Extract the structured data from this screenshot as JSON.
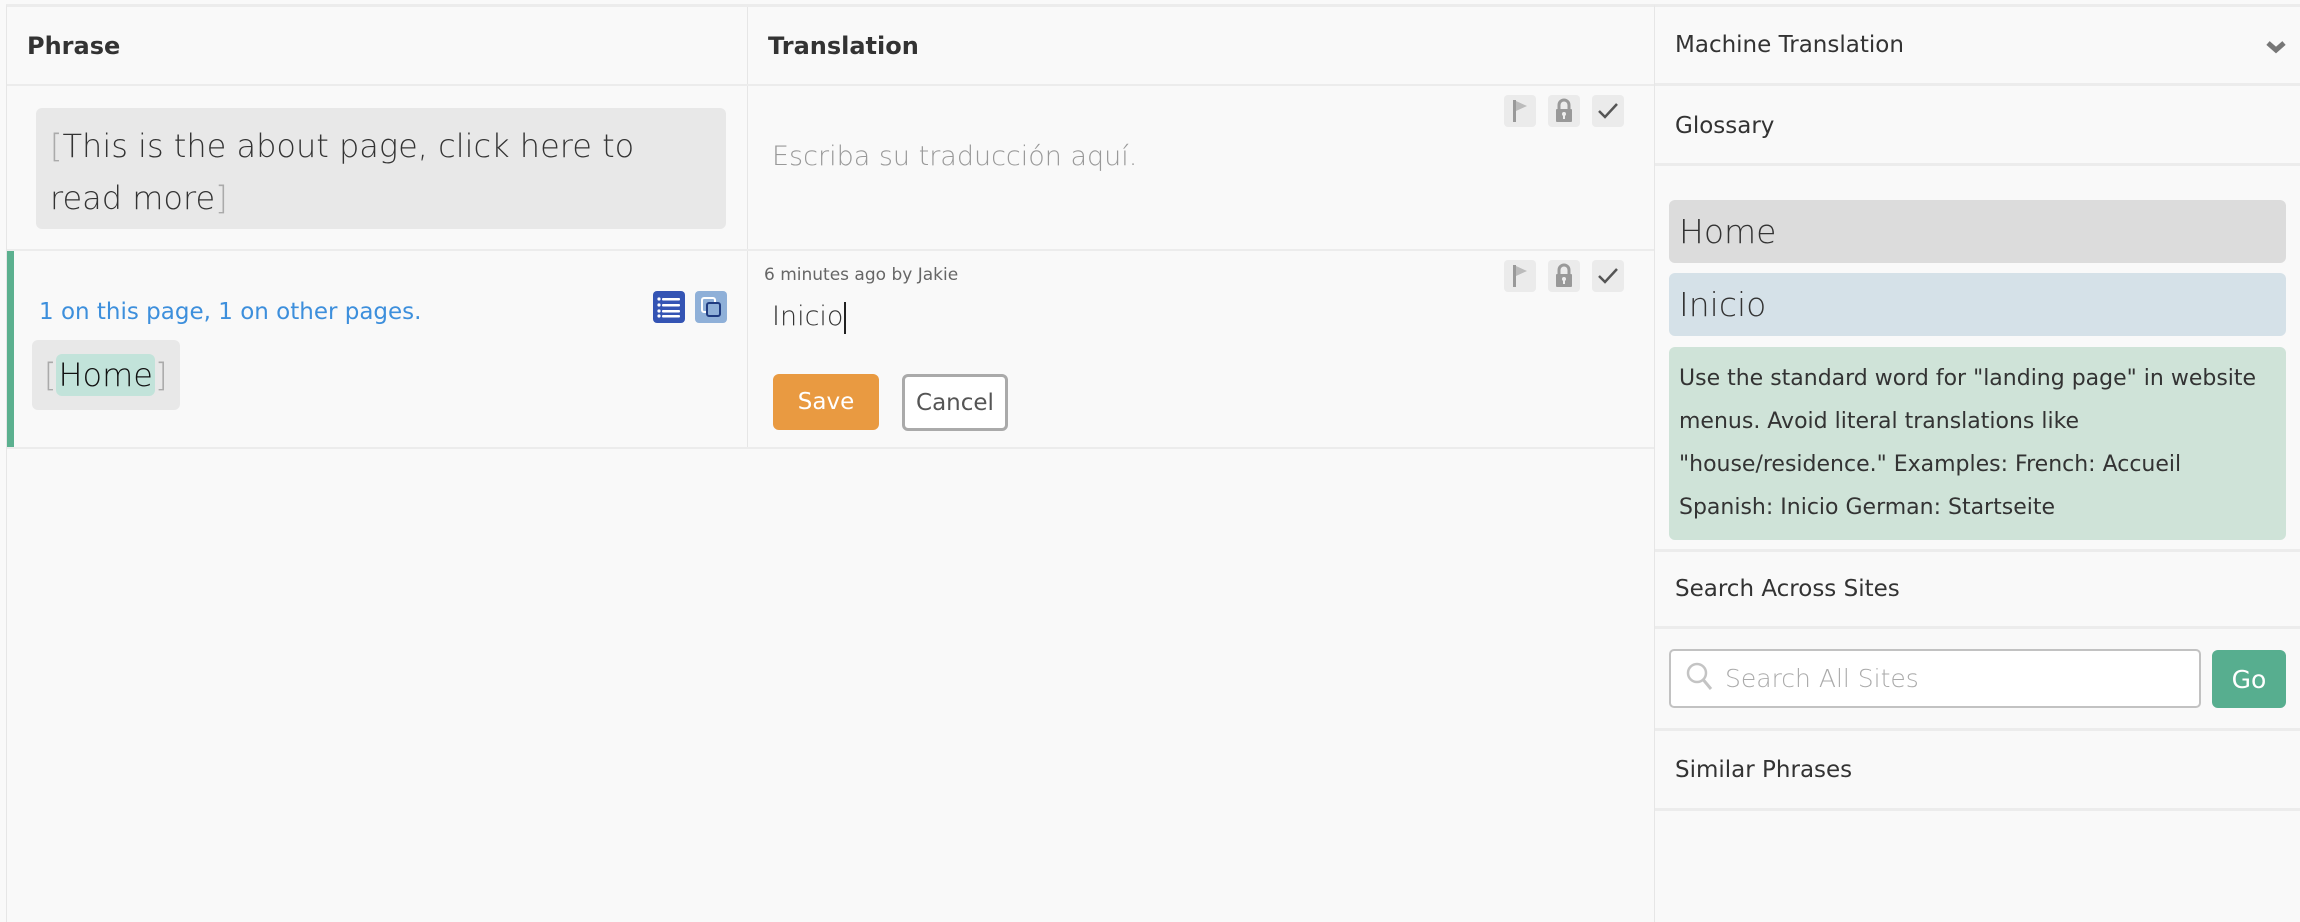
{
  "table": {
    "headers": {
      "phrase": "Phrase",
      "translation": "Translation"
    },
    "rows": [
      {
        "phrase": {
          "open_bracket": "[",
          "text": "This is the about page, click here to read more",
          "close_bracket": "]"
        },
        "translation": {
          "placeholder": "Escriba su traducción aquí."
        }
      },
      {
        "usage": "1 on this page, 1 on other pages.",
        "phrase": {
          "open_bracket": "[",
          "text": "Home",
          "close_bracket": "]"
        },
        "translation": {
          "meta": "6 minutes ago by Jakie",
          "value": "Inicio",
          "save_label": "Save",
          "cancel_label": "Cancel"
        }
      }
    ]
  },
  "icons": {
    "flag": "flag-icon",
    "lock": "lock-icon",
    "check": "check-icon",
    "list": "list-icon",
    "copy": "copy-icon",
    "search": "search-icon",
    "chevron": "chevron-down-icon"
  },
  "sidebar": {
    "machine_translation": "Machine Translation",
    "glossary": {
      "title": "Glossary",
      "source_term": "Home",
      "target_term": "Inicio",
      "note": "Use the standard word for \"landing page\" in website menus. Avoid literal translations like \"house/residence.\" Examples: French: Accueil Spanish: Inicio German: Startseite"
    },
    "search": {
      "title": "Search Across Sites",
      "placeholder": "Search All Sites",
      "value": "",
      "go_label": "Go"
    },
    "similar_phrases": "Similar Phrases"
  },
  "colors": {
    "accent_green": "#57ae8f",
    "save_orange": "#e99a41",
    "link_blue": "#3d8fdc",
    "list_icon_blue": "#3454b4",
    "copy_icon_blue": "#8fb0d8"
  }
}
